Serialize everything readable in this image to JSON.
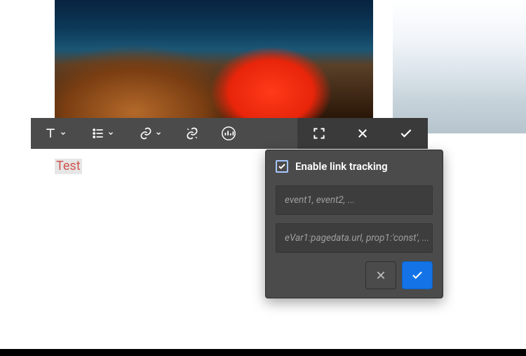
{
  "toolbar": {
    "text_tool": "Text style",
    "list_tool": "List style",
    "link_tool": "Link",
    "unlink_tool": "Unlink",
    "analytics_tool": "Analytics",
    "fullscreen": "Fullscreen",
    "close": "Close",
    "confirm": "Confirm"
  },
  "sample_text": "Test",
  "popover": {
    "checkbox_label": "Enable link tracking",
    "checkbox_checked": true,
    "events_placeholder": "event1, event2, ...",
    "evars_placeholder": "eVar1:pagedata.url, prop1:'const', ...",
    "cancel": "Cancel",
    "confirm": "Confirm"
  }
}
